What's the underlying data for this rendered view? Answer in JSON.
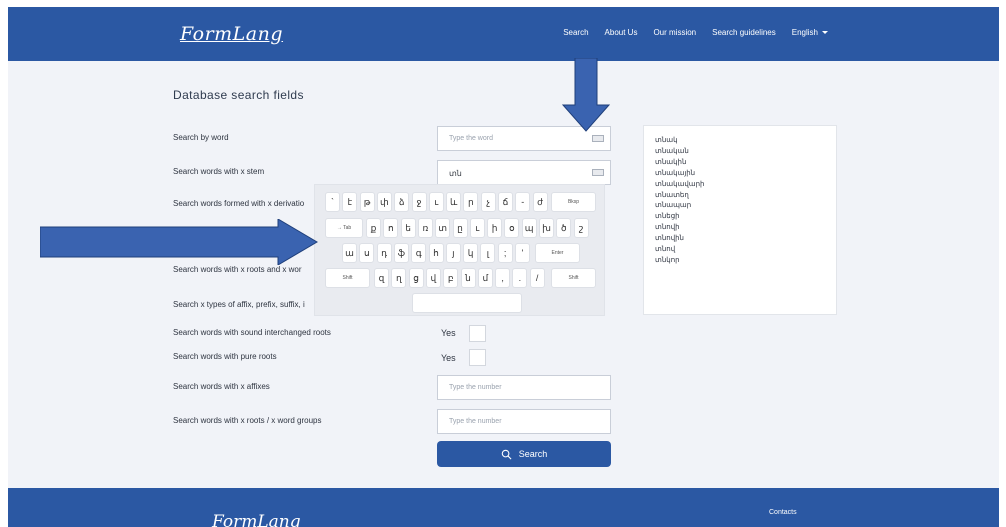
{
  "header": {
    "logo": "FormLang",
    "nav": [
      "Search",
      "About Us",
      "Our mission",
      "Search guidelines"
    ],
    "language": "English"
  },
  "main": {
    "title": "Database search fields",
    "labels": {
      "by_word": "Search by word",
      "with_stem": "Search words with x stem",
      "derivational": "Search words formed with x derivatio",
      "roots_words": "Search words with x roots and x wor",
      "affix_types": "Search x types of affix, prefix, suffix, i",
      "sound_interchanged": "Search words with sound interchanged roots",
      "pure_roots": "Search words with pure roots",
      "x_affixes": "Search words with x affixes",
      "roots_groups": "Search words with x roots / x word groups"
    },
    "word_placeholder": "Type the word",
    "stem_value": "տն",
    "yes_label": "Yes",
    "number_placeholder": "Type the number",
    "search_button": "Search"
  },
  "results": [
    "տնակ",
    "տնական",
    "տնակին",
    "տնակային",
    "տնակավարի",
    "տնատեղ",
    "տնապար",
    "տնեցի",
    "տնովի",
    "տնովին",
    "տնով",
    "տնկոր"
  ],
  "keyboard": {
    "row1": [
      "`",
      "է",
      "թ",
      "փ",
      "ձ",
      "ջ",
      "ւ",
      "և",
      "ր",
      "չ",
      "ճ",
      "-",
      "ժ"
    ],
    "bksp": "Bksp",
    "tab": "→ Tab",
    "row2": [
      "ք",
      "ո",
      "ե",
      "ռ",
      "տ",
      "ը",
      "ւ",
      "ի",
      "օ",
      "պ",
      "խ",
      "ծ",
      "շ"
    ],
    "row3": [
      "ա",
      "ս",
      "դ",
      "ֆ",
      "գ",
      "հ",
      "յ",
      "կ",
      "լ",
      ";",
      "'"
    ],
    "enter": "Enter",
    "shift": "Shift",
    "row4": [
      "զ",
      "ղ",
      "ց",
      "վ",
      "բ",
      "ն",
      "մ",
      ",",
      ".",
      "/"
    ]
  },
  "footer": {
    "logo": "FormLang",
    "contacts": "Contacts"
  },
  "colors": {
    "brand": "#2b58a3",
    "background": "#f1f3f8",
    "arrow": "#3a63b0"
  }
}
